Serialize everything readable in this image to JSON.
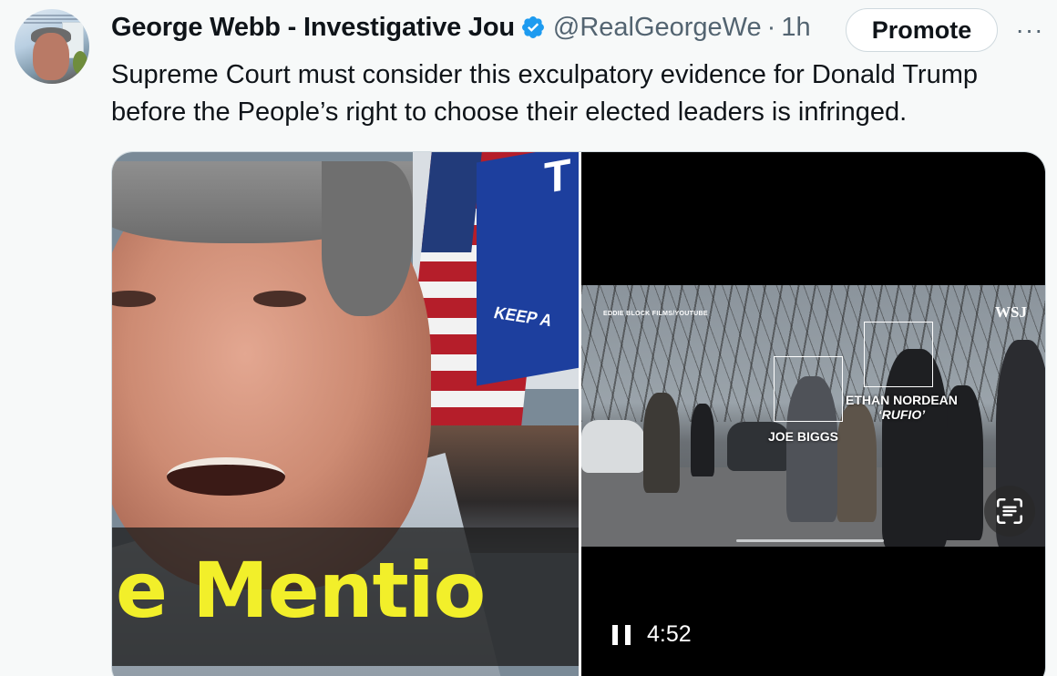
{
  "tweet": {
    "author_name": "George Webb - Investigative Jou",
    "handle": "@RealGeorgeWe",
    "separator": "·",
    "time": "1h",
    "promote_label": "Promote",
    "more_label": "···",
    "text": "Supreme Court must consider this exculpatory evidence for Donald Trump before the People’s right to choose their elected leaders is infringed."
  },
  "media": {
    "left": {
      "caption": "e Mentio",
      "flag_text_keep": "KEEP A",
      "flag_text_t": "T"
    },
    "right": {
      "credit": "EDDIE BLOCK FILMS/YOUTUBE",
      "watermark": "WSJ",
      "label_joe": "JOE BIGGS",
      "label_ethan": "ETHAN NORDEAN",
      "label_ethan_nick": "‘RUFIO’",
      "duration": "4:52",
      "icons": {
        "pause": "pause-icon",
        "text_recognition": "text-recognition-icon"
      }
    }
  },
  "colors": {
    "verified": "#1d9bf0",
    "caption_yellow": "#f2ef2a",
    "secondary_text": "#536471"
  }
}
